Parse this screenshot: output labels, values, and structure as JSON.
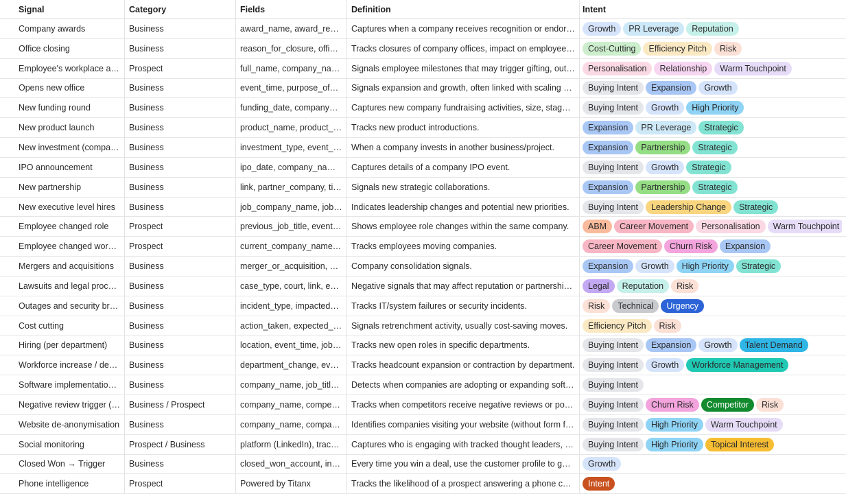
{
  "columns": [
    "Signal",
    "Category",
    "Fields",
    "Definition",
    "Intent"
  ],
  "tag_colors": {
    "Growth": "#d6e4fb",
    "PR Leverage": "#cde8f7",
    "Reputation": "#c6f0ea",
    "Cost-Cutting": "#cdeecd",
    "Efficiency Pitch": "#fbe9c4",
    "Risk": "#fbe0d6",
    "Personalisation": "#fbd9e4",
    "Relationship": "#f7d6f1",
    "Warm Touchpoint": "#e6dcf8",
    "Buying Intent": "#e4e6ea",
    "Expansion": "#a9c7f5",
    "High Priority": "#8fd3f5",
    "Strategic": "#82e3d3",
    "Partnership": "#95de85",
    "Leadership Change": "#f8d57e",
    "ABM": "#f9bb9b",
    "Career Movement": "#f8b6c4",
    "Churn Risk": "#f3a4dd",
    "Legal": "#c3a8f3",
    "Technical": "#c8cace",
    "Urgency": "#2c63d6",
    "Talent Demand": "#2fb6e6",
    "Workforce Management": "#1fc9b4",
    "Competitor": "#128a2e",
    "Topical Interest": "#f7be33",
    "Intent": "#c8511f"
  },
  "dark_tags": [
    "Urgency",
    "Competitor",
    "Intent"
  ],
  "rows": [
    {
      "signal": "Company awards",
      "category": "Business",
      "fields": "award_name, award_reason, award_date",
      "definition": "Captures when a company receives recognition or endorsements",
      "intent": [
        "Growth",
        "PR Leverage",
        "Reputation"
      ]
    },
    {
      "signal": "Office closing",
      "category": "Business",
      "fields": "reason_for_closure, office_location",
      "definition": "Tracks closures of company offices, impact on employees, and",
      "intent": [
        "Cost-Cutting",
        "Efficiency Pitch",
        "Risk"
      ]
    },
    {
      "signal": "Employee's workplace anniversary",
      "category": "Prospect",
      "fields": "full_name, company_name, years",
      "definition": "Signals employee milestones that may trigger gifting, outreach",
      "intent": [
        "Personalisation",
        "Relationship",
        "Warm Touchpoint"
      ]
    },
    {
      "signal": "Opens new office",
      "category": "Business",
      "fields": "event_time, purpose_of_new_office",
      "definition": "Signals expansion and growth, often linked with scaling plans.",
      "intent": [
        "Buying Intent",
        "Expansion",
        "Growth"
      ]
    },
    {
      "signal": "New funding round",
      "category": "Business",
      "fields": "funding_date, company_name, amount",
      "definition": "Captures new company fundraising activities, size, stage, and more",
      "intent": [
        "Buying Intent",
        "Growth",
        "High Priority"
      ]
    },
    {
      "signal": "New product launch",
      "category": "Business",
      "fields": "product_name, product_description",
      "definition": "Tracks new product introductions.",
      "intent": [
        "Expansion",
        "PR Leverage",
        "Strategic"
      ]
    },
    {
      "signal": "New investment (company invests)",
      "category": "Business",
      "fields": "investment_type, event_time",
      "definition": "When a company invests in another business/project.",
      "intent": [
        "Expansion",
        "Partnership",
        "Strategic"
      ]
    },
    {
      "signal": "IPO announcement",
      "category": "Business",
      "fields": "ipo_date, company_name, exchange",
      "definition": "Captures details of a company IPO event.",
      "intent": [
        "Buying Intent",
        "Growth",
        "Strategic"
      ]
    },
    {
      "signal": "New partnership",
      "category": "Business",
      "fields": "link, partner_company, title, date",
      "definition": "Signals new strategic collaborations.",
      "intent": [
        "Expansion",
        "Partnership",
        "Strategic"
      ]
    },
    {
      "signal": "New executive level hires",
      "category": "Business",
      "fields": "job_company_name, job_department",
      "definition": "Indicates leadership changes and potential new priorities.",
      "intent": [
        "Buying Intent",
        "Leadership Change",
        "Strategic"
      ]
    },
    {
      "signal": "Employee changed role",
      "category": "Prospect",
      "fields": "previous_job_title, event_time",
      "definition": "Shows employee role changes within the same company.",
      "intent": [
        "ABM",
        "Career Movement",
        "Personalisation",
        "Warm Touchpoint"
      ]
    },
    {
      "signal": "Employee changed workplace",
      "category": "Prospect",
      "fields": "current_company_name, current_title",
      "definition": "Tracks employees moving companies.",
      "intent": [
        "Career Movement",
        "Churn Risk",
        "Expansion"
      ]
    },
    {
      "signal": "Mergers and acquisitions",
      "category": "Business",
      "fields": "merger_or_acquisition, description",
      "definition": "Company consolidation signals.",
      "intent": [
        "Expansion",
        "Growth",
        "High Priority",
        "Strategic"
      ]
    },
    {
      "signal": "Lawsuits and legal proceedings",
      "category": "Business",
      "fields": "case_type, court, link, event_time",
      "definition": "Negative signals that may affect reputation or partnerships.",
      "intent": [
        "Legal",
        "Reputation",
        "Risk"
      ]
    },
    {
      "signal": "Outages and security breaches",
      "category": "Business",
      "fields": "incident_type, impacted_systems",
      "definition": "Tracks IT/system failures or security incidents.",
      "intent": [
        "Risk",
        "Technical",
        "Urgency"
      ]
    },
    {
      "signal": "Cost cutting",
      "category": "Business",
      "fields": "action_taken, expected_savings",
      "definition": "Signals retrenchment activity, usually cost-saving moves.",
      "intent": [
        "Efficiency Pitch",
        "Risk"
      ]
    },
    {
      "signal": "Hiring (per department)",
      "category": "Business",
      "fields": "location, event_time, job_count",
      "definition": "Tracks new open roles in specific departments.",
      "intent": [
        "Buying Intent",
        "Expansion",
        "Growth",
        "Talent Demand"
      ]
    },
    {
      "signal": "Workforce increase / decrease",
      "category": "Business",
      "fields": "department_change, event_time",
      "definition": "Tracks headcount expansion or contraction by department.",
      "intent": [
        "Buying Intent",
        "Growth",
        "Workforce Management"
      ]
    },
    {
      "signal": "Software implementation (tech)",
      "category": "Business",
      "fields": "company_name, job_title, date",
      "definition": "Detects when companies are adopting or expanding software tools",
      "intent": [
        "Buying Intent"
      ]
    },
    {
      "signal": "Negative review trigger (competitor)",
      "category": "Business / Prospect",
      "fields": "company_name, competitor_name",
      "definition": "Tracks when competitors receive negative reviews or poor ratings",
      "intent": [
        "Buying Intent",
        "Churn Risk",
        "Competitor",
        "Risk"
      ]
    },
    {
      "signal": "Website de-anonymisation",
      "category": "Business",
      "fields": "company_name, company_domain",
      "definition": "Identifies companies visiting your website (without form fills) and",
      "intent": [
        "Buying Intent",
        "High Priority",
        "Warm Touchpoint"
      ]
    },
    {
      "signal": "Social monitoring",
      "category": "Prospect / Business",
      "fields": "platform (LinkedIn), tracked_profiles",
      "definition": "Captures who is engaging with tracked thought leaders, accounts",
      "intent": [
        "Buying Intent",
        "High Priority",
        "Topical Interest"
      ]
    },
    {
      "signal": "Closed Won → Trigger",
      "category": "Business",
      "fields": "closed_won_account, industry",
      "definition": "Every time you win a deal, use the customer profile to generate",
      "intent": [
        "Growth"
      ]
    },
    {
      "signal": "Phone intelligence",
      "category": "Prospect",
      "fields": "Powered by Titanx",
      "definition": "Tracks the likelihood of a prospect answering a phone call. Powered",
      "intent": [
        "Intent"
      ]
    }
  ]
}
